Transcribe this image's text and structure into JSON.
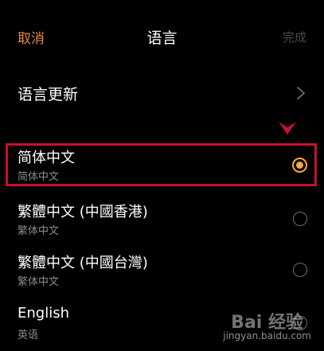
{
  "header": {
    "cancel_label": "取消",
    "title": "语言",
    "done_label": "完成"
  },
  "update_row": {
    "label": "语言更新",
    "icon": "chevron-right-icon"
  },
  "languages": [
    {
      "name": "简体中文",
      "sub": "简体中文",
      "selected": true
    },
    {
      "name": "繁體中文 (中國香港)",
      "sub": "繁体中文",
      "selected": false
    },
    {
      "name": "繁體中文 (中國台灣)",
      "sub": "繁体中文",
      "selected": false
    },
    {
      "name": "English",
      "sub": "英语",
      "selected": false
    }
  ],
  "colors": {
    "accent": "#f7a93a",
    "cancel": "#e8893f",
    "highlight": "#c8102e",
    "background": "#000000"
  },
  "watermark": {
    "logo_text": "Bai 经验",
    "url": "jingyan.baidu.com"
  }
}
